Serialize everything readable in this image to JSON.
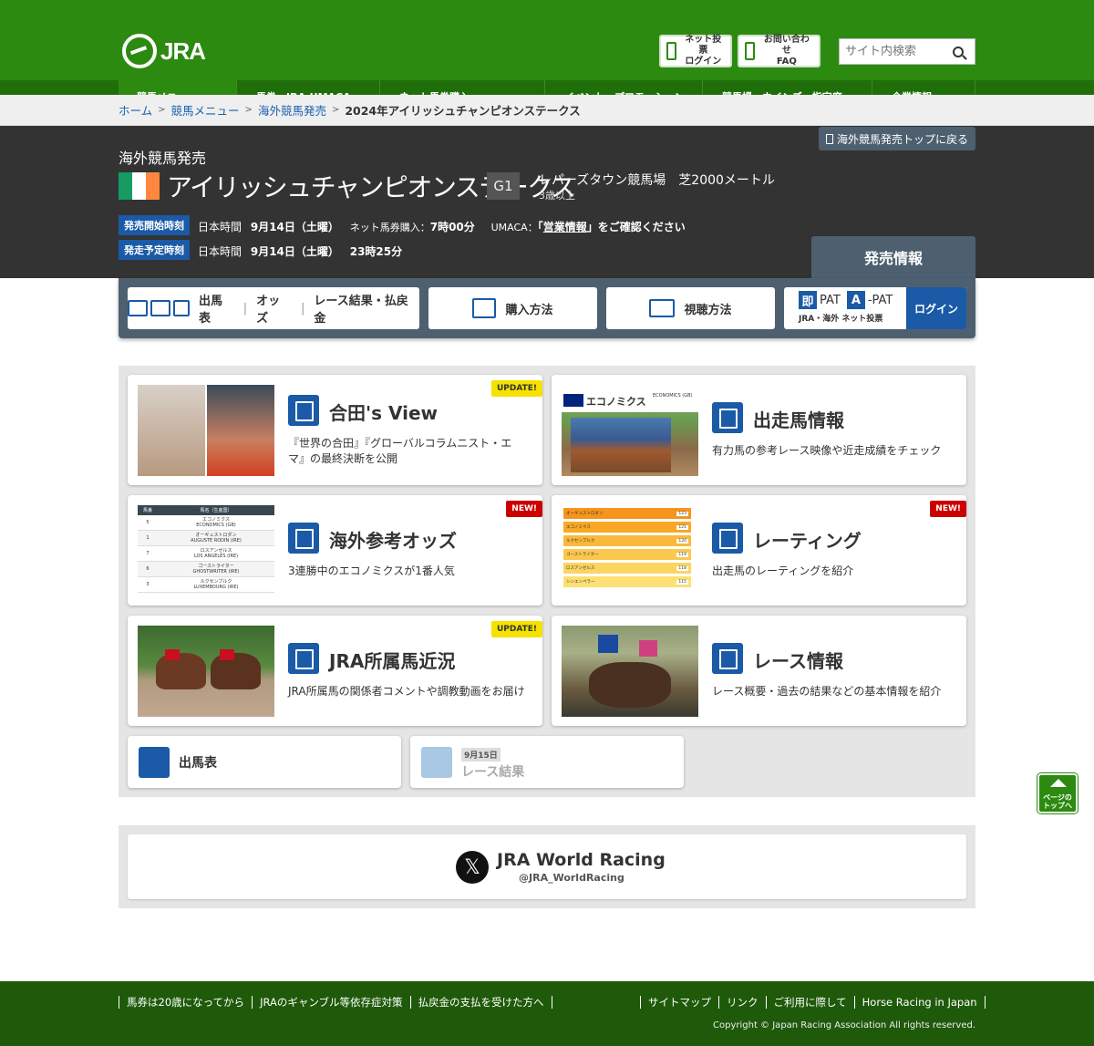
{
  "header": {
    "logo_text": "JRA",
    "net_vote_label": "ネット投票\nログイン",
    "contact_label": "お問い合わせ\nFAQ",
    "search_placeholder": "サイト内検索",
    "nav": [
      "競馬メニュー",
      "馬券・JRA-UMACA",
      "ネット馬券購入",
      "イベント・プロモーション",
      "競馬場・ウインズ・指定席",
      "企業情報"
    ]
  },
  "breadcrumb": {
    "items": [
      "ホーム",
      "競馬メニュー",
      "海外競馬発売"
    ],
    "current": "2024年アイリッシュチャンピオンステークス"
  },
  "race": {
    "back_label": "海外競馬発売トップに戻る",
    "category": "海外競馬発売",
    "name": "アイリッシュチャンピオンステークス",
    "grade": "G1",
    "venue": "レパーズタウン競馬場　芝2000メートル",
    "age": "3歳以上",
    "flag_colors": [
      "#169b62",
      "#ffffff",
      "#ff883e"
    ],
    "start_label": "発売開始時刻",
    "start_prefix": "日本時間",
    "start_date": "9月14日（土曜）",
    "start_net_label": "ネット馬券購入：",
    "start_net_time": "7時00分",
    "start_umaca_label": "UMACA：",
    "start_umaca_q1": "「",
    "start_umaca_link": "営業情報",
    "start_umaca_q2": "」をご確認ください",
    "end_label": "発走予定時刻",
    "end_prefix": "日本時間",
    "end_date": "9月14日（土曜）",
    "end_time": "23時25分",
    "sale_tab": "発売情報"
  },
  "linkbar": {
    "entries": [
      "出馬表",
      "オッズ",
      "レース結果・払戻金"
    ],
    "buy": "購入方法",
    "watch": "視聴方法",
    "pat_soku": "即",
    "pat_a": "A",
    "pat_text1": "PAT",
    "pat_text2": "-PAT",
    "pat_sub": "JRA・海外 ネット投票",
    "login": "ログイン"
  },
  "cards": [
    {
      "title": "合田's View",
      "desc": "『世界の合田』『グローバルコラムニスト・エマ』の最終決断を公開",
      "badge": "UPDATE!"
    },
    {
      "title": "出走馬情報",
      "desc": "有力馬の参考レース映像や近走成績をチェック",
      "badge": "",
      "img_caption": "エコノミクス",
      "img_sub": "ECONOMICS (GB)"
    },
    {
      "title": "海外参考オッズ",
      "desc": "3連勝中のエコノミクスが1番人気",
      "badge": "NEW!"
    },
    {
      "title": "レーティング",
      "desc": "出走馬のレーティングを紹介",
      "badge": "NEW!"
    },
    {
      "title": "JRA所属馬近況",
      "desc": "JRA所属馬の関係者コメントや調教動画をお届け",
      "badge": "UPDATE!"
    },
    {
      "title": "レース情報",
      "desc": "レース概要・過去の結果などの基本情報を紹介",
      "badge": ""
    }
  ],
  "small_cards": {
    "entries": "出馬表",
    "result_date": "9月15日",
    "result": "レース結果"
  },
  "odds_table": {
    "header": [
      "馬番",
      "馬名（生産国）"
    ],
    "rows": [
      {
        "no": "5",
        "jp": "エコノミクス",
        "en": "ECONOMICS (GB)"
      },
      {
        "no": "1",
        "jp": "オーギュストロダン",
        "en": "AUGUSTE RODIN (IRE)"
      },
      {
        "no": "7",
        "jp": "ロスアンゼルス",
        "en": "LOS ANGELES (IRE)"
      },
      {
        "no": "6",
        "jp": "ゴーストライター",
        "en": "GHOSTWRITER (IRE)"
      },
      {
        "no": "3",
        "jp": "ルクセンブルク",
        "en": "LUXEMBOURG (IRE)"
      }
    ]
  },
  "rating_bars": [
    {
      "name": "オーギュストロダン",
      "value": "123"
    },
    {
      "name": "エコノミクス",
      "value": "121"
    },
    {
      "name": "ルクセンブルク",
      "value": "120"
    },
    {
      "name": "ゴーストライター",
      "value": "119"
    },
    {
      "name": "ロスアンゼルス",
      "value": "118"
    },
    {
      "name": "シンエンペラー",
      "value": "115"
    }
  ],
  "twitter": {
    "name": "JRA World Racing",
    "handle": "@JRA_WorldRacing"
  },
  "pagetop": "ページの\nトップへ",
  "footer": {
    "left": [
      "馬券は20歳になってから",
      "JRAのギャンブル等依存症対策",
      "払戻金の支払を受けた方へ"
    ],
    "right": [
      "サイトマップ",
      "リンク",
      "ご利用に際して",
      "Horse Racing in Japan"
    ],
    "copyright": "Copyright © Japan Racing Association All rights reserved."
  }
}
